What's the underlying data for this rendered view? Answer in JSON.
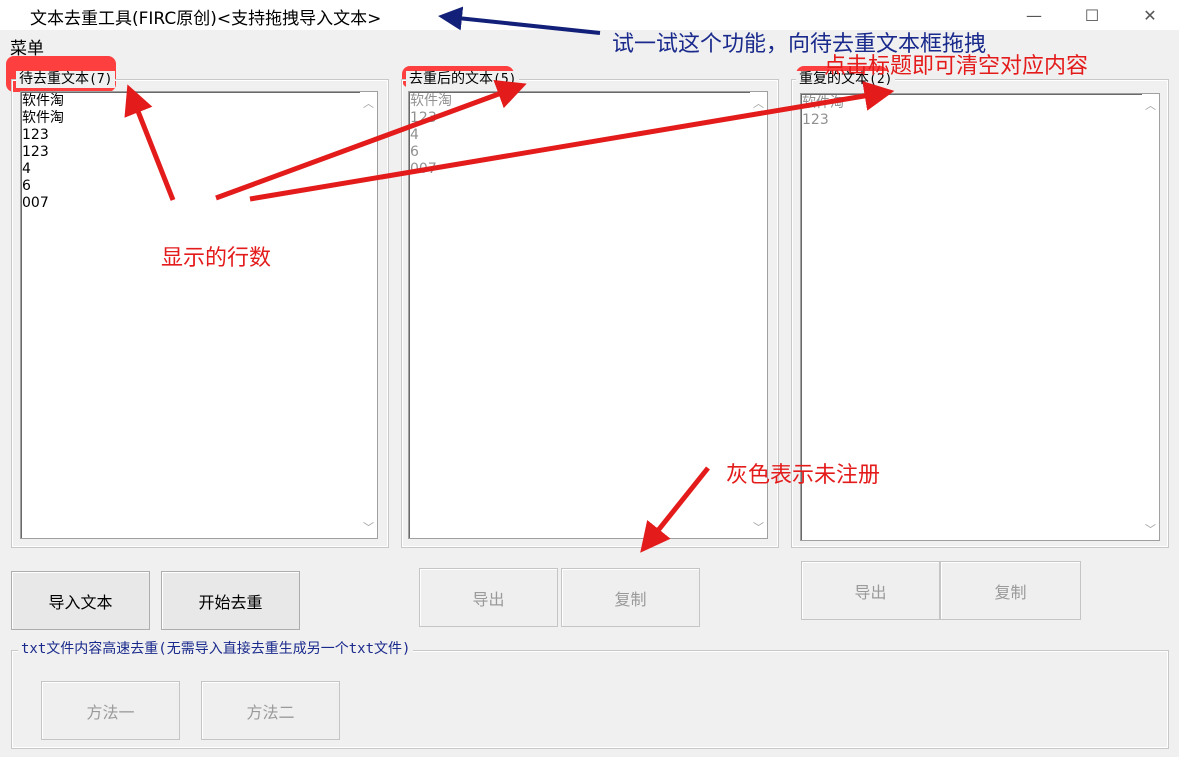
{
  "window": {
    "title": "文本去重工具(FIRC原创)<支持拖拽导入文本>",
    "minimize": "—",
    "maximize": "☐",
    "close": "✕"
  },
  "menu": {
    "label": "菜单"
  },
  "panels": {
    "input": {
      "title": "待去重文本",
      "count": "(7)",
      "lines": [
        "软件淘",
        "软件淘",
        "123",
        "123",
        "4",
        "6",
        "007"
      ]
    },
    "output": {
      "title": "去重后的文本",
      "count": "(5)",
      "lines": [
        "软件淘",
        "123",
        "4",
        "6",
        "007"
      ]
    },
    "dupes": {
      "title": "重复的文本",
      "count": "(2)",
      "lines": [
        "软件淘",
        "123"
      ]
    }
  },
  "buttons": {
    "import": "导入文本",
    "start": "开始去重",
    "export1": "导出",
    "copy1": "复制",
    "export2": "导出",
    "copy2": "复制"
  },
  "txt_group": {
    "title": "txt文件内容高速去重(无需导入直接去重生成另一个txt文件)",
    "method1": "方法一",
    "method2": "方法二"
  },
  "annotations": {
    "drag": "试一试这个功能，向待去重文本框拖拽",
    "clear": "点击标题即可清空对应内容",
    "line_count": "显示的行数",
    "unregistered": "灰色表示未注册"
  },
  "colors": {
    "annotation_red": "#e41b1b",
    "annotation_navy": "#1a2a8c",
    "disabled_text": "#9a9a9a"
  }
}
